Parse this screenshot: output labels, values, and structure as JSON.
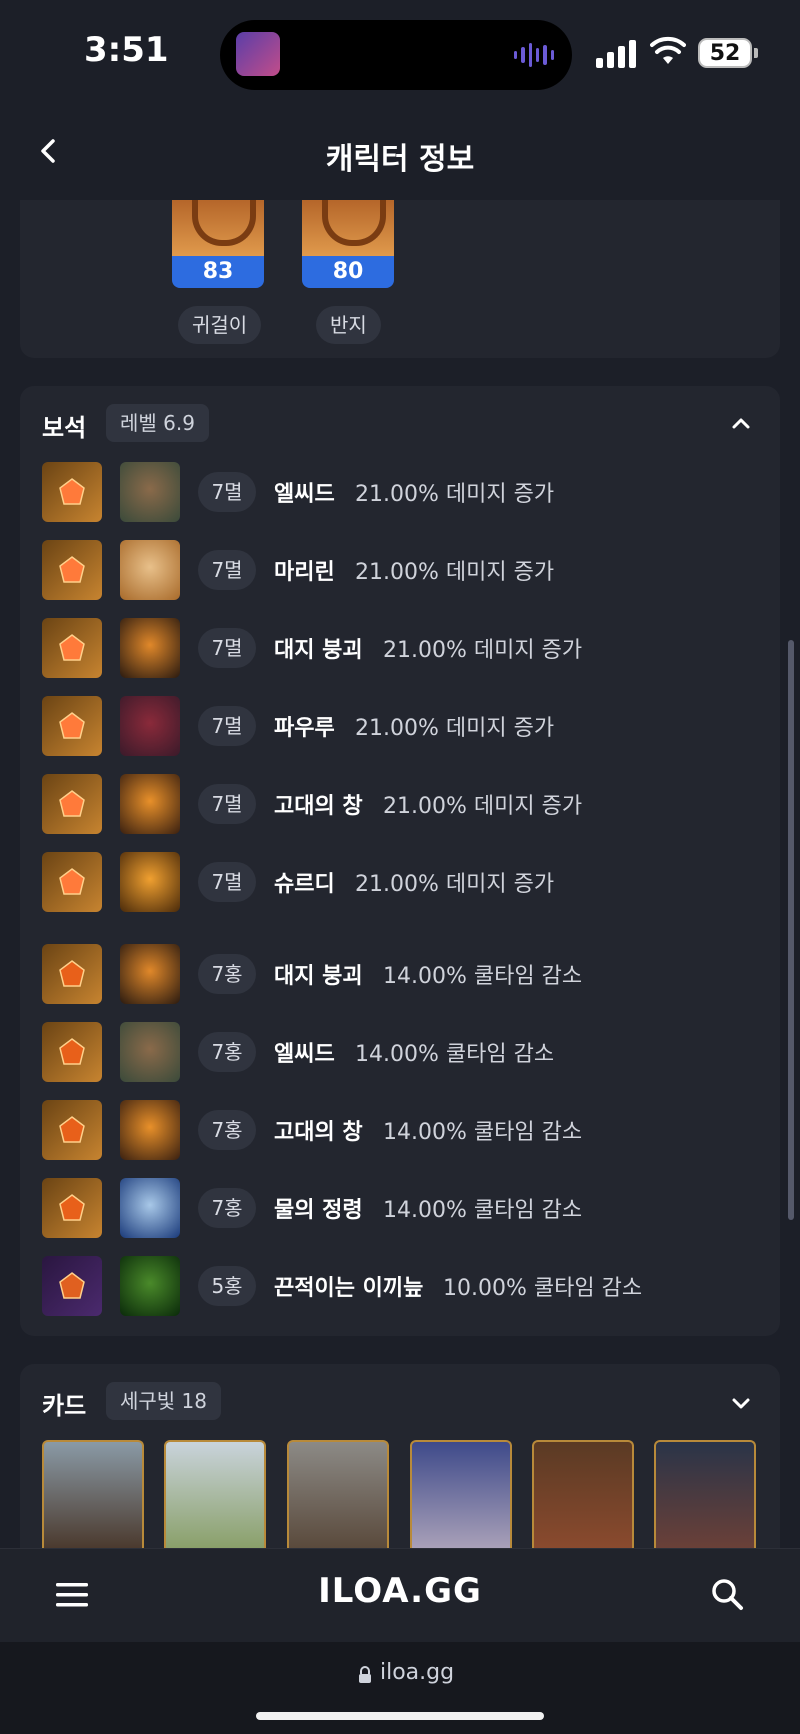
{
  "status_bar": {
    "time": "3:51",
    "battery": "52"
  },
  "header": {
    "title": "캐릭터 정보"
  },
  "accessories": [
    {
      "level": "83",
      "label": "귀걸이"
    },
    {
      "level": "80",
      "label": "반지"
    }
  ],
  "gems_section": {
    "title": "보석",
    "badge": "레벨 6.9",
    "items": [
      {
        "level": "7멸",
        "skill": "엘씨드",
        "effect": "21.00% 데미지 증가"
      },
      {
        "level": "7멸",
        "skill": "마리린",
        "effect": "21.00% 데미지 증가"
      },
      {
        "level": "7멸",
        "skill": "대지 붕괴",
        "effect": "21.00% 데미지 증가"
      },
      {
        "level": "7멸",
        "skill": "파우루",
        "effect": "21.00% 데미지 증가"
      },
      {
        "level": "7멸",
        "skill": "고대의 창",
        "effect": "21.00% 데미지 증가"
      },
      {
        "level": "7멸",
        "skill": "슈르디",
        "effect": "21.00% 데미지 증가"
      },
      {
        "level": "7홍",
        "skill": "대지 붕괴",
        "effect": "14.00% 쿨타임 감소"
      },
      {
        "level": "7홍",
        "skill": "엘씨드",
        "effect": "14.00% 쿨타임 감소"
      },
      {
        "level": "7홍",
        "skill": "고대의 창",
        "effect": "14.00% 쿨타임 감소"
      },
      {
        "level": "7홍",
        "skill": "물의 정령",
        "effect": "14.00% 쿨타임 감소"
      },
      {
        "level": "5홍",
        "skill": "끈적이는 이끼늪",
        "effect": "10.00% 쿨타임 감소"
      }
    ]
  },
  "cards_section": {
    "title": "카드",
    "badge": "세구빛 18"
  },
  "bottom_bar": {
    "logo": "ILOA.GG"
  },
  "url_bar": {
    "url": "iloa.gg"
  }
}
